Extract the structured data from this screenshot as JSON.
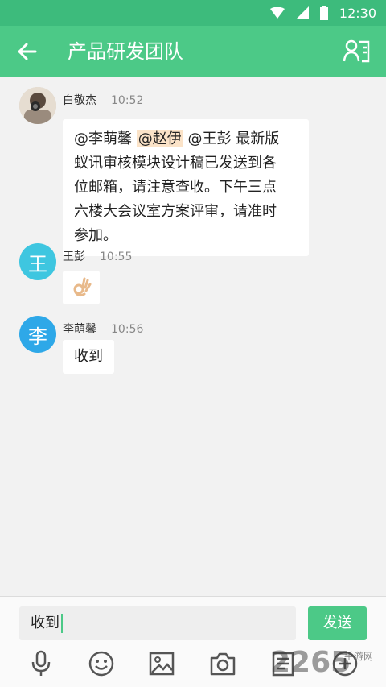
{
  "statusbar": {
    "time": "12:30"
  },
  "header": {
    "title": "产品研发团队",
    "back_icon": "arrow-left-icon",
    "members_icon": "group-members-icon"
  },
  "messages": [
    {
      "sender": "白敬杰",
      "time": "10:52",
      "mentions": [
        "@李萌馨",
        "@赵伊",
        "@王彭"
      ],
      "line1_rest": " 最新版",
      "line2": "蚁讯审核模块设计稿已发送到各",
      "line3": "位邮箱，请注意查收。下午三点",
      "line4": "六楼大会议室方案评审，请准时",
      "line5": "参加。"
    },
    {
      "sender": "王彭",
      "avatar_letter": "王",
      "time": "10:55",
      "content_icon": "ok-hand-emoji-icon",
      "avatar_color": "#3ec6e0"
    },
    {
      "sender": "李萌馨",
      "avatar_letter": "李",
      "time": "10:56",
      "content": "收到",
      "avatar_color": "#2ea8e8"
    }
  ],
  "composer": {
    "value": "收到",
    "send_label": "发送"
  },
  "toolbar_icons": [
    "microphone-icon",
    "smiley-icon",
    "image-icon",
    "camera-icon",
    "document-icon",
    "add-icon"
  ],
  "watermark": {
    "digits": "2265",
    "text": "手游网"
  },
  "colors": {
    "primary": "#4cc987",
    "statusbar": "#3dbb7c",
    "mention_highlight": "#fbe3c8"
  }
}
